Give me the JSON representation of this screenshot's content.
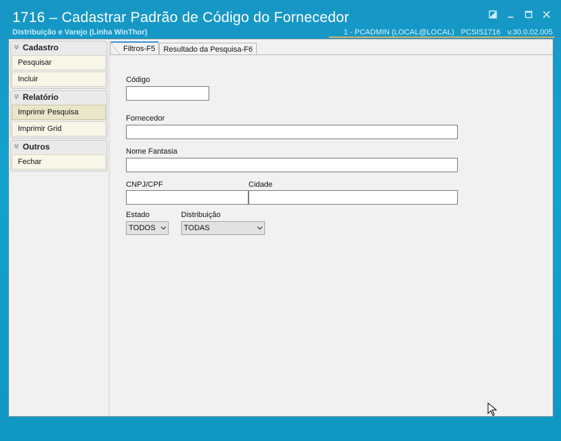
{
  "window": {
    "title": "1716 – Cadastrar Padrão de Código do Fornecedor",
    "subtitle": "Distribuição e Varejo (Linha WinThor)",
    "session_user": "1 - PCADMIN (LOCAL@LOCAL)",
    "session_module": "PCSIS1716",
    "session_version": "v.30.0.02.005"
  },
  "sidebar": {
    "groups": [
      {
        "title": "Cadastro",
        "items": [
          {
            "label": "Pesquisar"
          },
          {
            "label": "Incluir"
          }
        ]
      },
      {
        "title": "Relatório",
        "items": [
          {
            "label": "Imprimir Pesquisa"
          },
          {
            "label": "Imprimir Grid"
          }
        ]
      },
      {
        "title": "Outros",
        "items": [
          {
            "label": "Fechar"
          }
        ]
      }
    ]
  },
  "tabs": [
    {
      "label": "Filtros-F5"
    },
    {
      "label": "Resultado da Pesquisa-F6"
    }
  ],
  "form": {
    "codigo": {
      "label": "Código",
      "value": ""
    },
    "fornecedor": {
      "label": "Fornecedor",
      "value": ""
    },
    "nome_fantasia": {
      "label": "Nome Fantasia",
      "value": ""
    },
    "cnpj_cpf": {
      "label": "CNPJ/CPF",
      "value": ""
    },
    "cidade": {
      "label": "Cidade",
      "value": ""
    },
    "estado": {
      "label": "Estado",
      "selected": "TODOS"
    },
    "distribuicao": {
      "label": "Distribuição",
      "selected": "TODAS"
    }
  },
  "colors": {
    "background": "#12a3cf",
    "tab_accent": "#3a8fd6",
    "menu_item_bg": "#f8f6e6",
    "menu_item_active_bg": "#e9e6c9"
  }
}
